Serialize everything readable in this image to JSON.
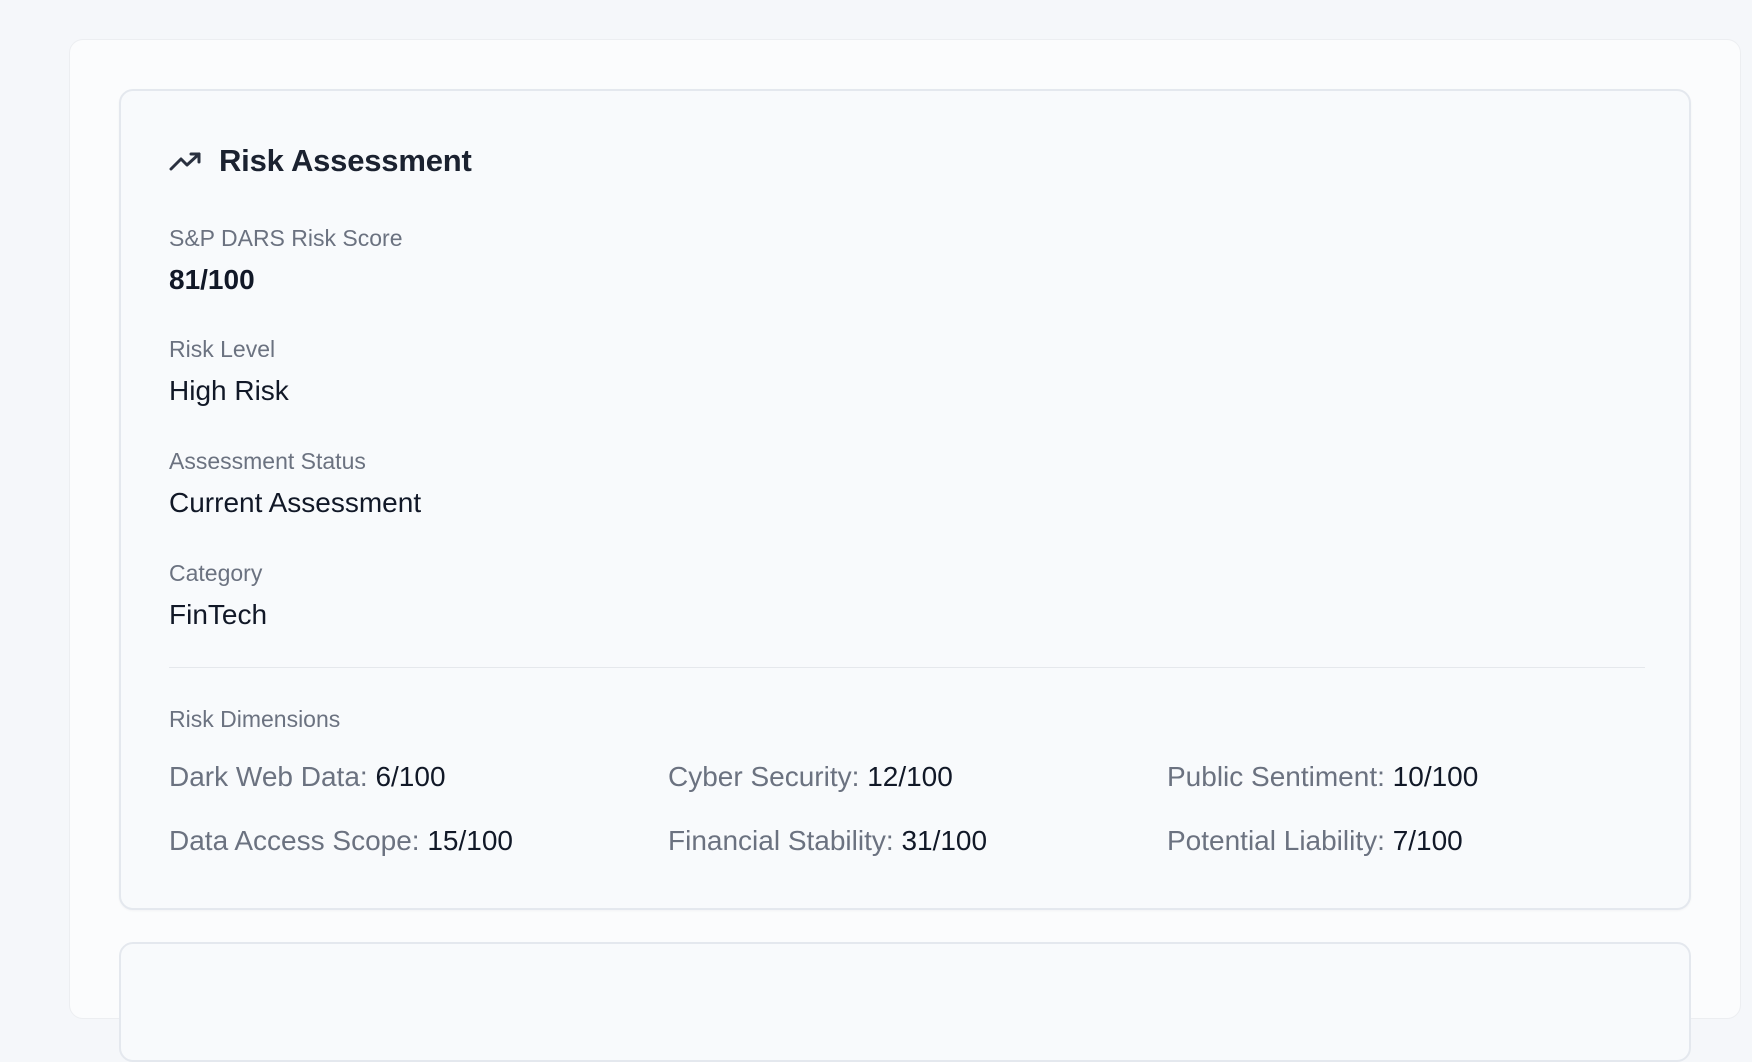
{
  "risk_card": {
    "title": "Risk Assessment",
    "title_icon": "trending-up-icon",
    "fields": [
      {
        "label": "S&P DARS Risk Score",
        "value": "81/100"
      },
      {
        "label": "Risk Level",
        "value": "High Risk"
      },
      {
        "label": "Assessment Status",
        "value": "Current Assessment"
      },
      {
        "label": "Category",
        "value": "FinTech"
      }
    ],
    "dimensions_label": "Risk Dimensions",
    "dimensions": [
      {
        "name": "Dark Web Data:",
        "value": "6/100"
      },
      {
        "name": "Cyber Security:",
        "value": "12/100"
      },
      {
        "name": "Public Sentiment:",
        "value": "10/100"
      },
      {
        "name": "Data Access Scope:",
        "value": "15/100"
      },
      {
        "name": "Financial Stability:",
        "value": "31/100"
      },
      {
        "name": "Potential Liability:",
        "value": "7/100"
      }
    ]
  },
  "colors": {
    "page_bg": "#f5f7fa",
    "card_bg": "#f8fafc",
    "label": "#6b7280",
    "value": "#111827"
  }
}
